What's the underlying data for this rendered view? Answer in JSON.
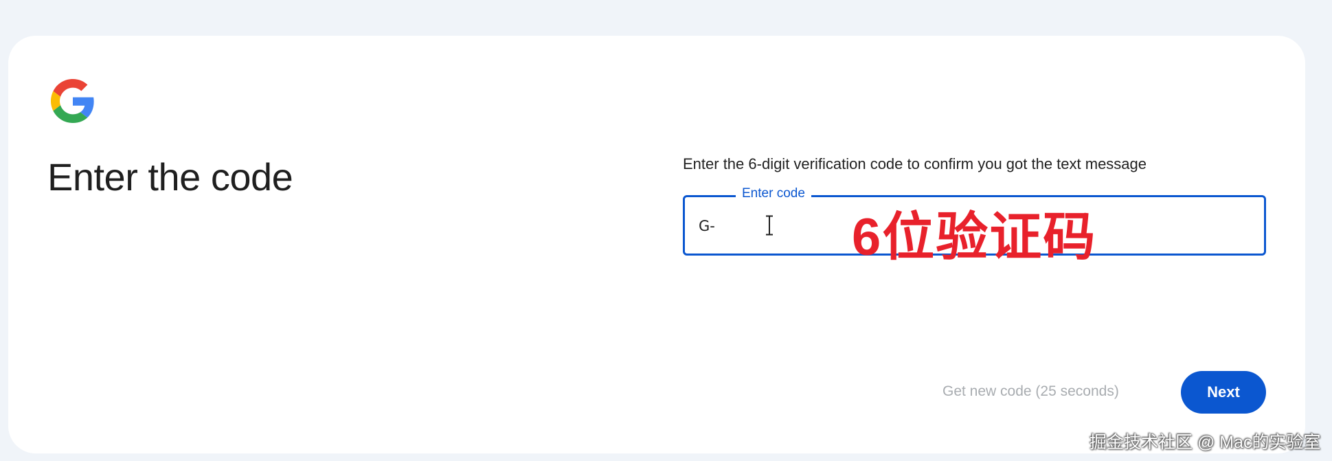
{
  "page": {
    "title": "Enter the code",
    "instructions": "Enter the 6-digit verification code to confirm you got the text message"
  },
  "code_input": {
    "label": "Enter code",
    "prefix": "G-",
    "value": ""
  },
  "annotation": {
    "text": "6位验证码",
    "color": "#e8212b"
  },
  "actions": {
    "resend_label": "Get new code (25 seconds)",
    "next_label": "Next"
  },
  "watermark": {
    "text": "掘金技术社区 @ Mac的实验室"
  },
  "theme": {
    "accent": "#0b57d0",
    "background": "#f0f4f9",
    "card": "#ffffff",
    "text": "#1f1f1f",
    "disabled_text": "#a8acb0"
  },
  "icons": {
    "logo": "google-g-icon",
    "cursor": "text-cursor-icon"
  }
}
